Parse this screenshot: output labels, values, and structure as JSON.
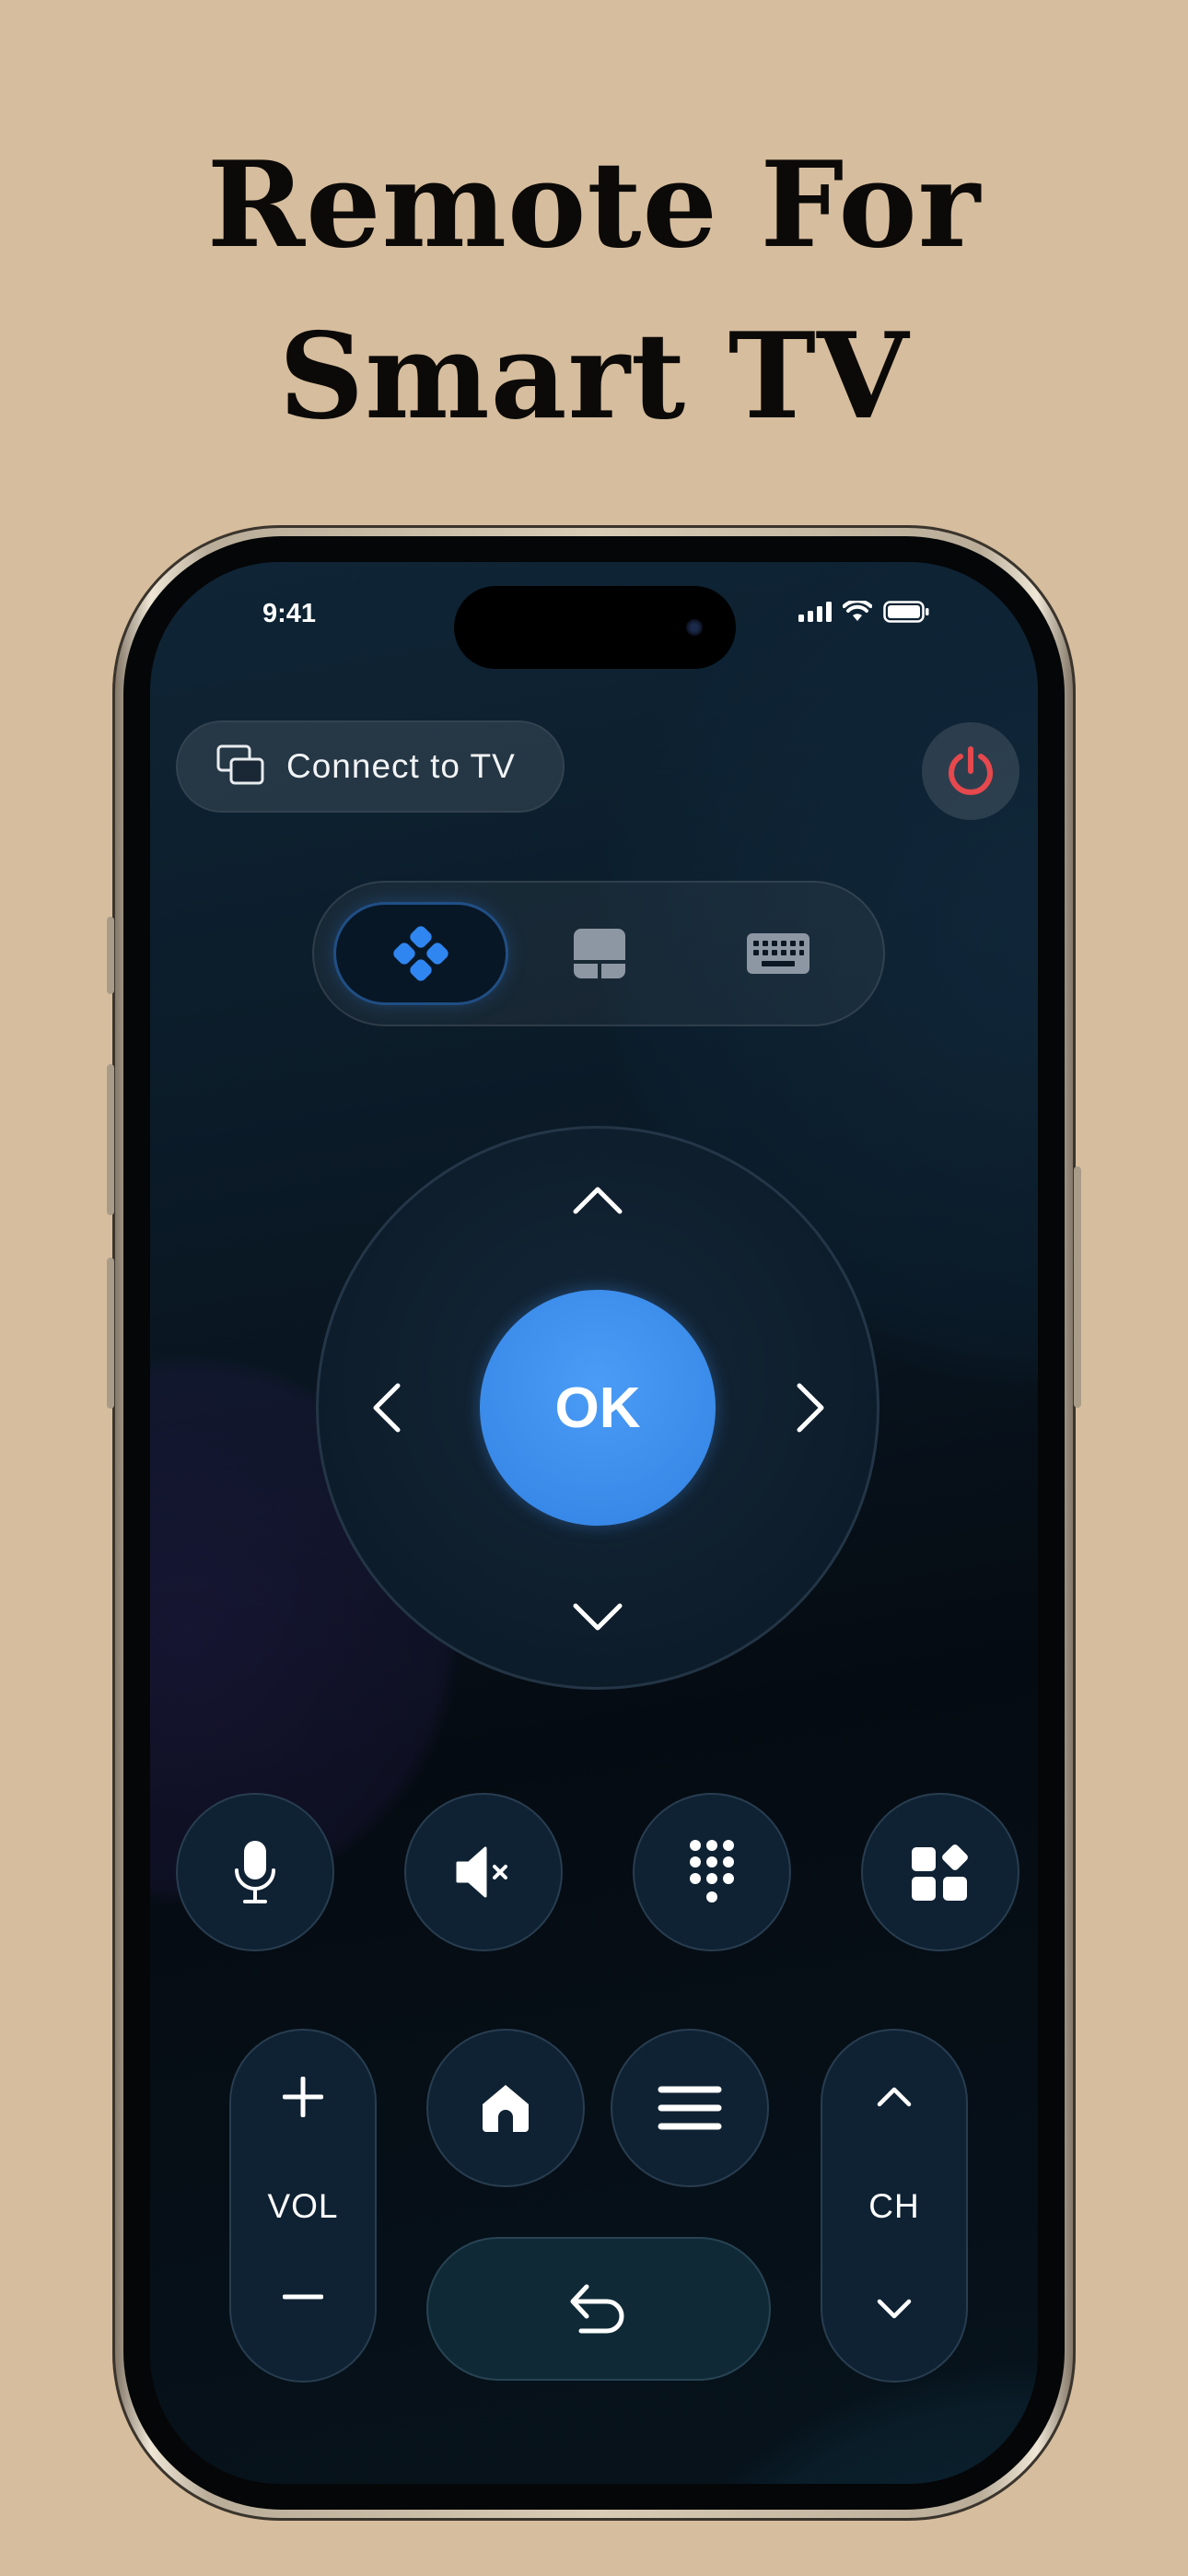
{
  "headline": {
    "line1": "Remote For",
    "line2": "Smart TV"
  },
  "status_bar": {
    "time": "9:41",
    "icons": [
      "cellular-signal-icon",
      "wifi-icon",
      "battery-icon"
    ]
  },
  "connect": {
    "label": "Connect to TV",
    "icon": "screen-mirror-icon"
  },
  "power": {
    "icon": "power-icon",
    "color": "#e5484d"
  },
  "modes": {
    "active_color": "#2f86f0",
    "inactive_color": "#8d97a3",
    "tabs": [
      {
        "name": "dpad",
        "icon": "gamepad-icon",
        "active": true
      },
      {
        "name": "touchpad",
        "icon": "touchpad-icon",
        "active": false
      },
      {
        "name": "keyboard",
        "icon": "keyboard-icon",
        "active": false
      }
    ]
  },
  "dpad": {
    "ok_label": "OK",
    "ok_color": "#3d8ef0"
  },
  "action_buttons": [
    "microphone-icon",
    "mute-icon",
    "numpad-icon",
    "apps-icon"
  ],
  "volume": {
    "label": "VOL"
  },
  "channel": {
    "label": "CH"
  },
  "nav_buttons": [
    "home-icon",
    "menu-icon",
    "back-icon"
  ]
}
